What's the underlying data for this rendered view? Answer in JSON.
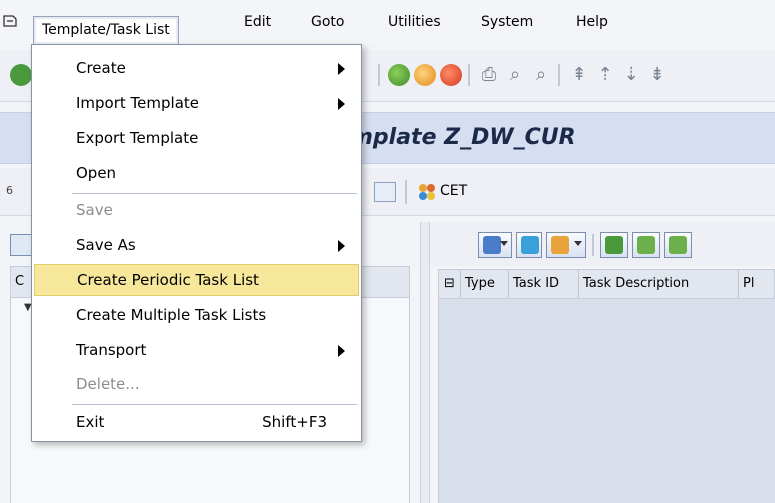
{
  "menubar": {
    "items": [
      "Template/Task List",
      "Edit",
      "Goto",
      "Utilities",
      "System",
      "Help"
    ]
  },
  "title": {
    "text": "mplate Z_DW_CUR"
  },
  "app_toolbar": {
    "left_number": "6",
    "cet_label": "CET"
  },
  "left_panel": {
    "column_header": "C"
  },
  "grid": {
    "columns": [
      "Type",
      "Task ID",
      "Task Description",
      "Pl"
    ]
  },
  "dropdown": {
    "items": [
      {
        "label": "Create",
        "submenu": true
      },
      {
        "label": "Import Template",
        "submenu": true
      },
      {
        "label": "Export Template"
      },
      {
        "label": "Open"
      },
      {
        "label": "Save",
        "disabled": true
      },
      {
        "label": "Save As",
        "submenu": true
      },
      {
        "label": "Create Periodic Task List",
        "highlighted": true
      },
      {
        "label": "Create Multiple Task Lists"
      },
      {
        "label": "Transport",
        "submenu": true
      },
      {
        "label": "Delete...",
        "disabled": true
      },
      {
        "label": "Exit",
        "shortcut": "Shift+F3"
      }
    ]
  },
  "colors": {
    "highlight": "#f6e79a",
    "titlebar": "#d6def2",
    "grid_body": "#d9dfea"
  }
}
